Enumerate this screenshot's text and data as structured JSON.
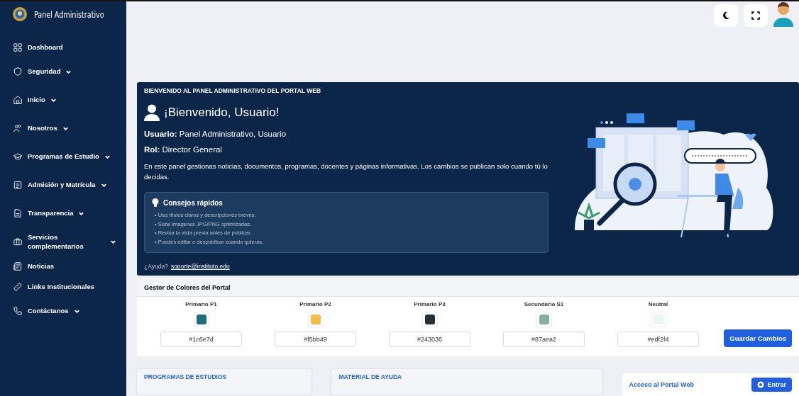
{
  "sidebar": {
    "title": "Panel Administrativo",
    "items": [
      {
        "label": "Dashboard",
        "expandable": false
      },
      {
        "label": "Seguridad",
        "expandable": true
      },
      {
        "label": "Inicio",
        "expandable": true
      },
      {
        "label": "Nosotros",
        "expandable": true
      },
      {
        "label": "Programas de Estudio",
        "expandable": true
      },
      {
        "label": "Admisión y Matrícula",
        "expandable": true
      },
      {
        "label": "Transparencia",
        "expandable": true
      },
      {
        "label": "Servicios complementarios",
        "expandable": true
      },
      {
        "label": "Noticias",
        "expandable": false
      },
      {
        "label": "Links Institucionales",
        "expandable": false
      },
      {
        "label": "Contáctanos",
        "expandable": true
      }
    ]
  },
  "welcome": {
    "heading": "BIENVENIDO AL PANEL ADMINISTRATIVO DEL PORTAL WEB",
    "greeting": "¡Bienvenido, Usuario!",
    "user_line": "**Usuario:** Panel Administrativo, Usuario",
    "role_line": "**Rol:** Director General",
    "description": "En este panel gestionas noticias, documentos, programas, docentes y páginas informativas. Los cambios se publican solo cuando tú lo decidas.",
    "tips": {
      "title": "Consejos rápidos",
      "items": [
        "• Usa títulos claros y descripciones breves.",
        "• Sube imágenes JPG/PNG optimizadas.",
        "• Revisa la vista previa antes de publicar.",
        "• Puedes editar o despublicar cuando quieras."
      ]
    },
    "help_label": "¿Ayuda?",
    "help_link": "soporte@instituto.edu"
  },
  "color_manager": {
    "title": "Gestor de Colores del Portal",
    "colors": [
      {
        "label": "Primario P1",
        "color": "#1c6e7d",
        "value": "#1c6e7d"
      },
      {
        "label": "Primario P2",
        "color": "#f5bb49",
        "value": "#f5bb49"
      },
      {
        "label": "Primario P3",
        "color": "#243036",
        "value": "#243036"
      },
      {
        "label": "Secundario S1",
        "color": "#87aea2",
        "value": "#87aea2"
      },
      {
        "label": "Neutral",
        "color": "#edf2f4",
        "value": "#edf2f4"
      }
    ],
    "save_button": "Guardar Cambios"
  },
  "bottom_cards": [
    {
      "title": "PROGRAMAS DE ESTUDIOS"
    },
    {
      "title": "MATERIAL DE AYUDA"
    }
  ],
  "portal_access": {
    "title": "Acceso al Portal Web",
    "button": "Entrar"
  }
}
